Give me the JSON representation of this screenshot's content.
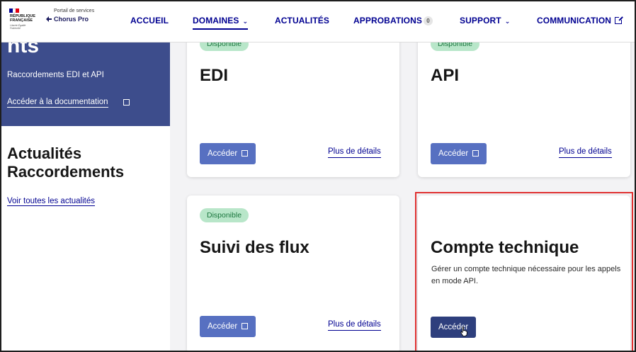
{
  "header": {
    "logo": {
      "republique": "RÉPUBLIQUE FRANÇAISE",
      "motto": "Liberté Égalité Fraternité",
      "portal_small": "Portail de services",
      "portal_name": "Chorus Pro",
      "flag_colors": [
        "#000091",
        "#ffffff",
        "#e1000f"
      ]
    },
    "nav": {
      "accueil": "ACCUEIL",
      "domaines": "DOMAINES",
      "actualites": "ACTUALITÉS",
      "approbations": "APPROBATIONS",
      "approbations_count": "0",
      "support": "SUPPORT",
      "communication": "COMMUNICATION"
    }
  },
  "left": {
    "banner_title": "nts",
    "banner_subtitle": "Raccordements EDI et API",
    "doc_link": "Accéder à la documentation",
    "actu_title_line1": "Actualités",
    "actu_title_line2": "Raccordements",
    "actu_link": "Voir toutes les actualités"
  },
  "cards": {
    "edi": {
      "tag": "Disponible",
      "title": "EDI",
      "button": "Accéder",
      "details": "Plus de détails"
    },
    "api": {
      "tag": "Disponible",
      "title": "API",
      "button": "Accéder",
      "details": "Plus de détails"
    },
    "suivi": {
      "tag": "Disponible",
      "title": "Suivi des flux",
      "button": "Accéder",
      "details": "Plus de détails"
    },
    "compte": {
      "title": "Compte technique",
      "description": "Gérer un compte technique nécessaire pour les appels en mode API.",
      "button": "Accéder"
    }
  },
  "colors": {
    "primary": "#000091",
    "banner": "#3d4d8c",
    "button": "#5770c1",
    "button_active": "#2e3f7d",
    "tag_bg": "#b8e6c9",
    "tag_text": "#18753c",
    "highlight": "#e03131"
  }
}
